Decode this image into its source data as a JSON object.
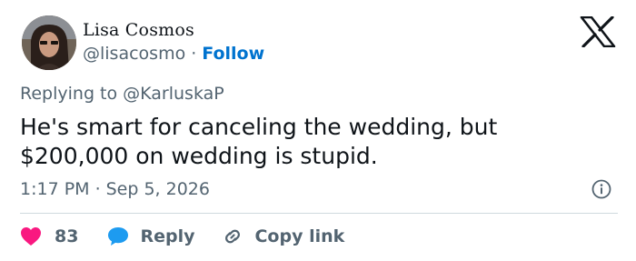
{
  "author": {
    "name": "Lisa Cosmos",
    "handle": "@lisacosmo",
    "separator": "·",
    "follow_label": "Follow"
  },
  "reply_to": "Replying to @KarluskaP",
  "tweet": {
    "text_line1": "He's smart for canceling the wedding, but",
    "text_line2": "$200,000 on wedding is stupid."
  },
  "meta": {
    "time": "1:17 PM",
    "separator": "·",
    "date": "Sep 5, 2026"
  },
  "actions": {
    "like_count": "83",
    "reply_label": "Reply",
    "copy_label": "Copy link"
  },
  "icons": {
    "like": "heart-icon",
    "reply": "speech-bubble-icon",
    "copy": "link-icon",
    "info": "info-icon",
    "brand": "x-logo-icon"
  },
  "colors": {
    "like": "#f91880",
    "reply": "#1d9bf0",
    "follow": "#0073cf",
    "muted": "#536471",
    "text": "#0f1419",
    "divider": "#cfd9de"
  }
}
